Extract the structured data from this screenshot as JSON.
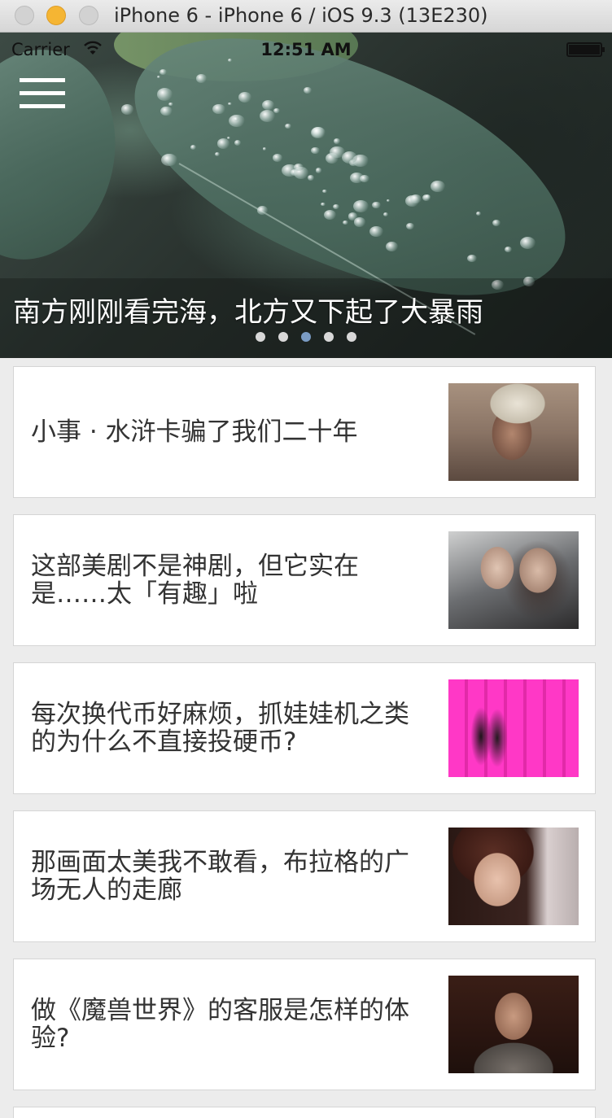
{
  "window": {
    "title": "iPhone 6 - iPhone 6 / iOS 9.3 (13E230)"
  },
  "status_bar": {
    "carrier": "Carrier",
    "time": "12:51 AM",
    "wifi_icon": "wifi-icon",
    "battery_icon": "battery-icon"
  },
  "header": {
    "menu_icon": "hamburger-menu-icon"
  },
  "banner": {
    "caption": "南方刚刚看完海，北方又下起了大暴雨",
    "page_count": 5,
    "active_page": 3,
    "colors": {
      "dot": "#d8d8d8",
      "dot_active": "#7a9cc4"
    }
  },
  "stories": [
    {
      "title": "小事 · 水浒卡骗了我们二十年",
      "thumbnail": "man-in-wide-hat-photo"
    },
    {
      "title": "这部美剧不是神剧，但它实在是……太「有趣」啦",
      "thumbnail": "two-women-selfie-photo"
    },
    {
      "title": "每次换代币好麻烦，抓娃娃机之类的为什么不直接投硬币?",
      "thumbnail": "arcade-claw-machines-photo"
    },
    {
      "title": "那画面太美我不敢看，布拉格的广场无人的走廊",
      "thumbnail": "woman-by-window-photo"
    },
    {
      "title": "做《魔兽世界》的客服是怎样的体验?",
      "thumbnail": "man-in-sweater-photo"
    }
  ]
}
